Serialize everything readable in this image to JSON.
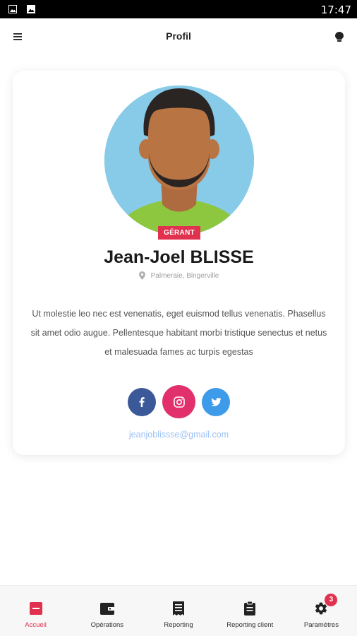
{
  "status_bar": {
    "time": "17:47"
  },
  "app_bar": {
    "title": "Profil"
  },
  "profile": {
    "role_badge": "GÉRANT",
    "name": "Jean-Joel BLISSE",
    "location": "Palmeraie, Bingerville",
    "bio": "Ut molestie leo nec est venenatis, eget euismod tellus venenatis. Phasellus sit amet odio augue. Pellentesque habitant morbi tristique senectus et netus et malesuada fames ac turpis egestas",
    "email": "jeanjoblissse@gmail.com",
    "social": [
      {
        "icon": "facebook-icon",
        "color": "#3b5998"
      },
      {
        "icon": "instagram-icon",
        "color": "#e1306c"
      },
      {
        "icon": "twitter-icon",
        "color": "#3d9be9"
      }
    ]
  },
  "bottom_nav": {
    "items": [
      {
        "label": "Accueil",
        "icon": "home-icon",
        "active": true
      },
      {
        "label": "Opérations",
        "icon": "wallet-icon",
        "active": false
      },
      {
        "label": "Reporting",
        "icon": "report-icon",
        "active": false
      },
      {
        "label": "Reporting client",
        "icon": "clipboard-icon",
        "active": false
      },
      {
        "label": "Paramètres",
        "icon": "settings-icon",
        "active": false,
        "badge": "3"
      }
    ]
  },
  "colors": {
    "accent": "#e0314f",
    "link": "#9cc1f5"
  }
}
